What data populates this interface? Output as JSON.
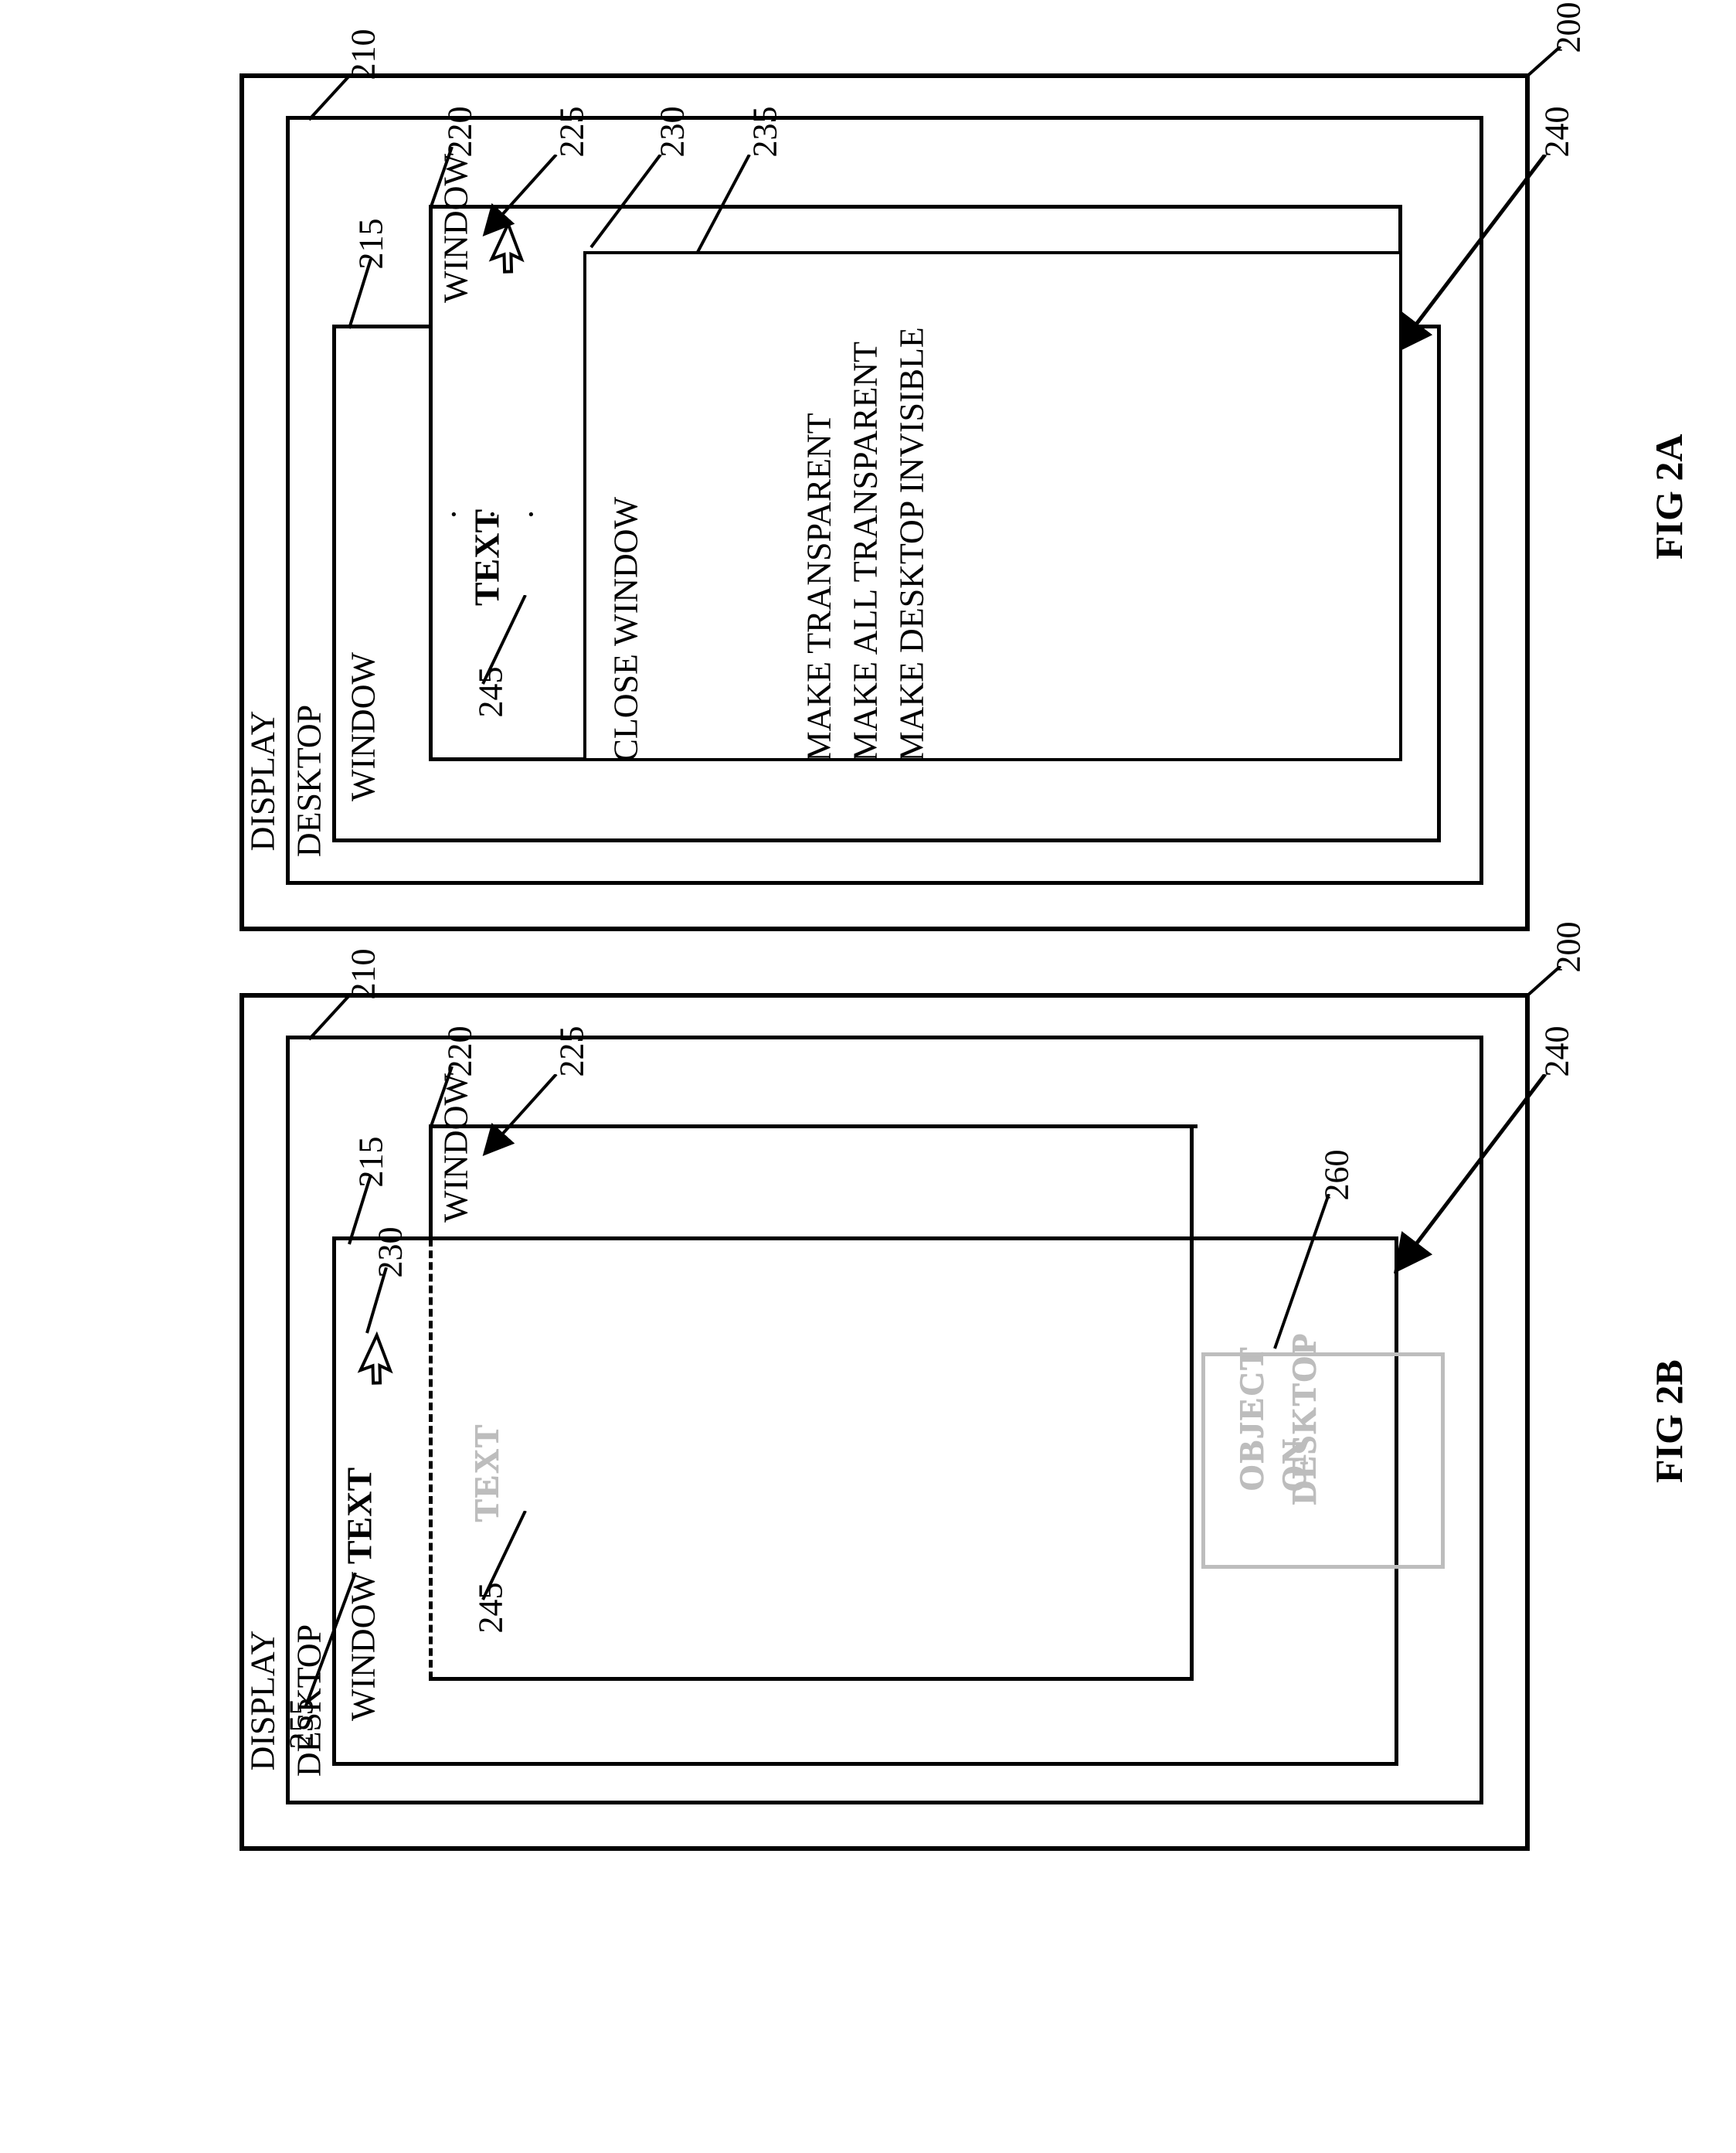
{
  "figA": {
    "title": "FIG 2A",
    "refs": {
      "display": "200",
      "desktop": "210",
      "win215": "215",
      "win220": "220",
      "cursor": "225",
      "menu230": "230",
      "menu235": "235",
      "winbody": "240",
      "text245": "245"
    },
    "labels": {
      "display": "DISPLAY",
      "desktop": "DESKTOP",
      "windowA": "WINDOW",
      "windowB": "WINDOW",
      "text": "TEXT"
    },
    "menu": {
      "close": "CLOSE WINDOW",
      "dot1": ".",
      "dot2": ".",
      "dot3": ".",
      "m1": "MAKE TRANSPARENT",
      "m2": "MAKE ALL TRANSPARENT",
      "m3": "MAKE DESKTOP INVISIBLE"
    }
  },
  "figB": {
    "title": "FIG 2B",
    "refs": {
      "display": "200",
      "desktop": "210",
      "win215": "215",
      "win220": "220",
      "cursor2": "225",
      "cursor1": "230",
      "winbody": "240",
      "text245": "245",
      "text255": "255",
      "obj260": "260"
    },
    "labels": {
      "display": "DISPLAY",
      "desktop": "DESKTOP",
      "windowA": "WINDOW",
      "windowB": "WINDOW",
      "textBold": "TEXT",
      "textGhost": "TEXT"
    },
    "obj": {
      "l1": "OBJECT",
      "l2": "ON",
      "l3": "DESKTOP"
    }
  }
}
